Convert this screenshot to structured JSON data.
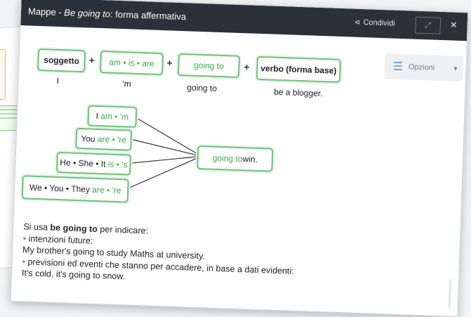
{
  "header": {
    "title_prefix": "Mappe - ",
    "title_italic": "Be going to",
    "title_suffix": ": forma affermativa",
    "share_label": "Condividi",
    "share_icon": "share-icon",
    "expand_icon": "expand-icon",
    "close_label": "×"
  },
  "options": {
    "label": "Opzioni",
    "icon": "menu-icon"
  },
  "formula": {
    "subject": "soggetto",
    "be_forms": "am • is • are",
    "going_to": "going to",
    "verb": "verbo (forma base)",
    "plus": "+",
    "example": {
      "subject": "I",
      "be": "'m",
      "going": "going to",
      "verb": "be a blogger."
    }
  },
  "tree": {
    "pronouns": [
      {
        "subject": "I",
        "forms": "am • 'm"
      },
      {
        "subject": "You",
        "forms": "are • 're"
      },
      {
        "subject": "He • She • It",
        "forms": "is • 's"
      },
      {
        "subject": "We • You • They",
        "forms": "are • 're"
      }
    ],
    "target_green": "going to",
    "target_rest": " win."
  },
  "notes": {
    "line1_prefix": "Si usa ",
    "line1_bold": "be going to",
    "line1_suffix": " per indicare:",
    "bullet1": "intenzioni future:",
    "example1": "My brother's going to study Maths at university.",
    "bullet2": "previsioni ed eventi che stanno per accadere, in base a dati evidenti:",
    "example2": "It's cold, it's going to snow."
  },
  "colors": {
    "accent_green": "#3fae4e",
    "box_border": "#6fc27a",
    "titlebar": "#2b3138"
  }
}
